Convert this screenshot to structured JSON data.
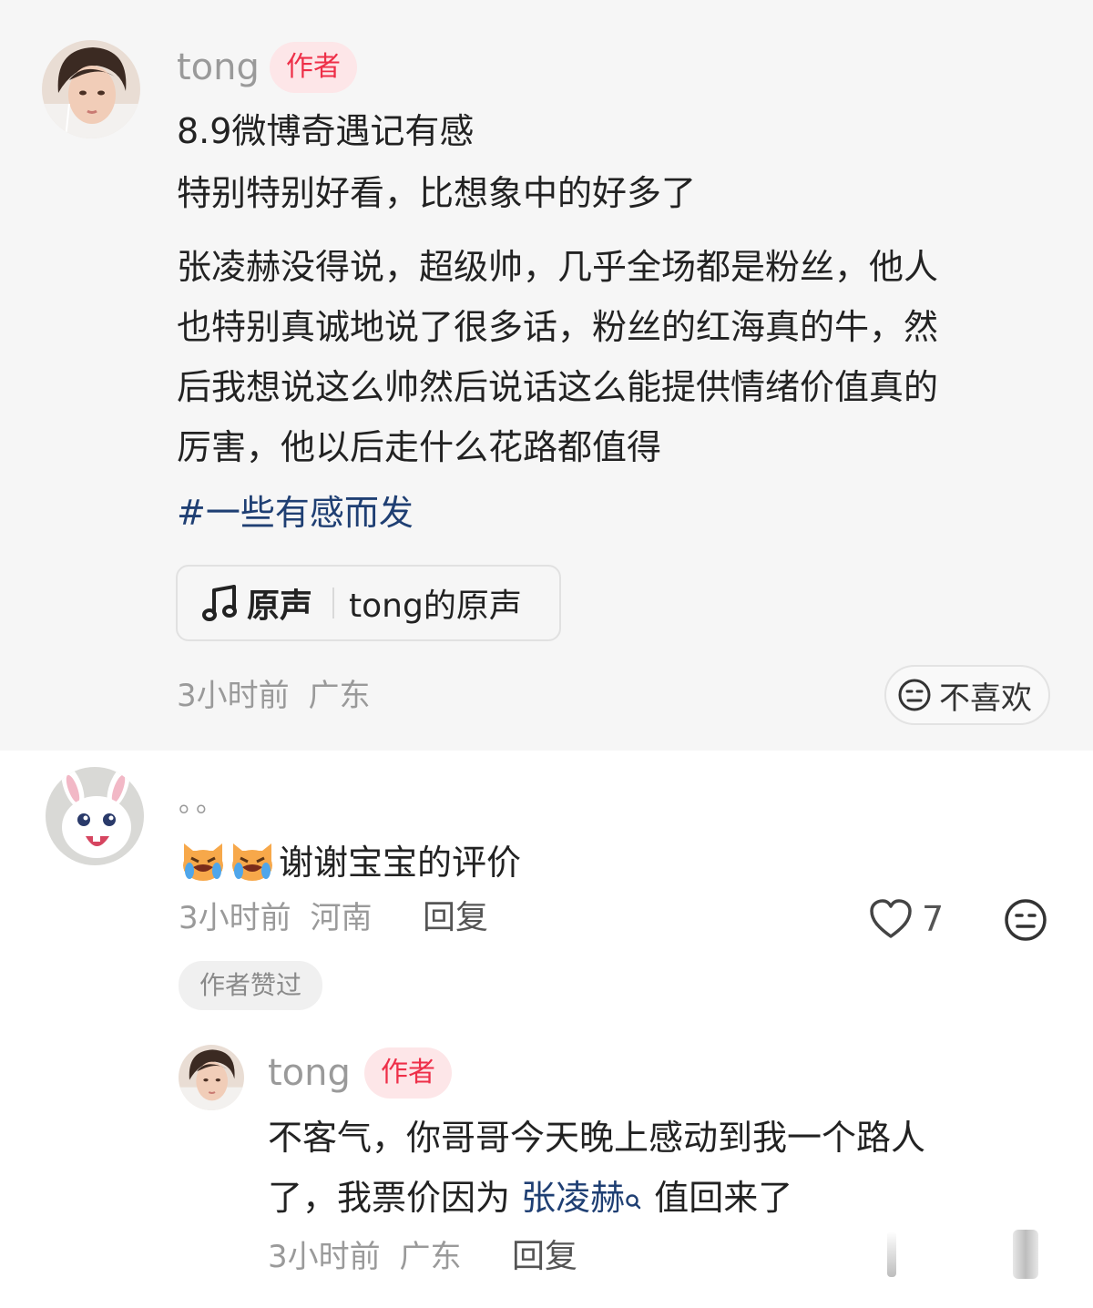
{
  "post": {
    "author": "tong",
    "author_tag": "作者",
    "title": "8.9微博奇遇记有感",
    "subtitle": "特别特别好看，比想象中的好多了",
    "body_lines": [
      "张凌赫没得说，超级帅，几乎全场都是粉丝，他人",
      "也特别真诚地说了很多话，粉丝的红海真的牛，然",
      "后我想说这么帅然后说话这么能提供情绪价值真的",
      "厉害，他以后走什么花路都值得"
    ],
    "hashtag": "#一些有感而发",
    "music": {
      "tag": "原声",
      "name": "tong的原声",
      "icon": "music-note-icon"
    },
    "time": "3小时前",
    "location": "广东",
    "dislike_label": "不喜欢"
  },
  "comment": {
    "username": "。。",
    "text": "谢谢宝宝的评价",
    "emoji": "crying-cat-emoji",
    "time": "3小时前",
    "location": "河南",
    "reply_label": "回复",
    "like_count": "7",
    "author_liked": "作者赞过"
  },
  "reply": {
    "username": "tong",
    "author_tag": "作者",
    "text_line1": "不客气，你哥哥今天晚上感动到我一个路人",
    "text_line2_pre": "了，我票价因为 ",
    "mention": "张凌赫",
    "text_line2_post": " 值回来了",
    "time": "3小时前",
    "location": "广东",
    "reply_label": "回复"
  }
}
